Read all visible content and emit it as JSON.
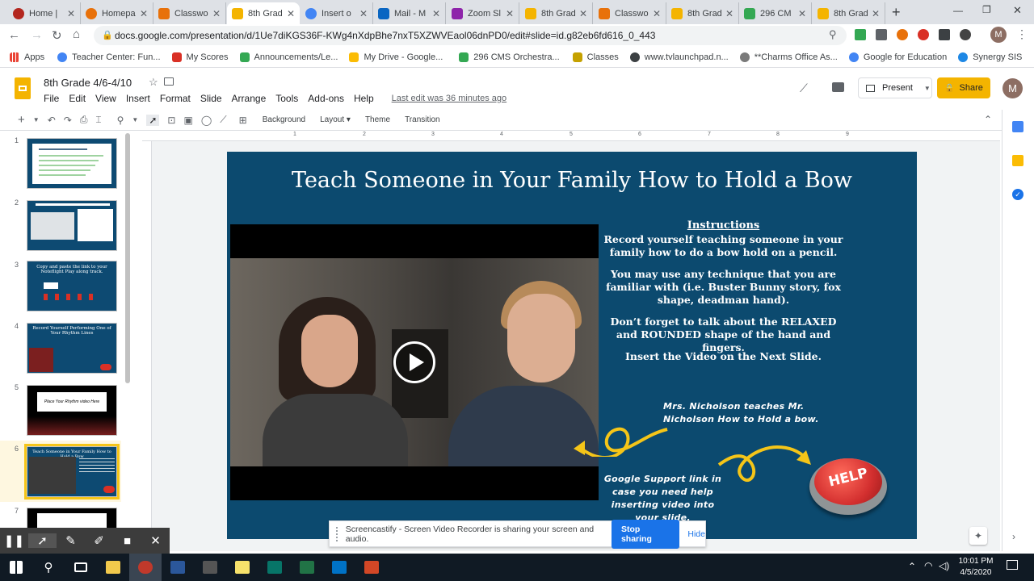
{
  "tabs": [
    {
      "label": "Home |",
      "color": "#b3261e"
    },
    {
      "label": "Homepa",
      "color": "#e8710a"
    },
    {
      "label": "Classwo",
      "color": "#e8710a"
    },
    {
      "label": "8th Grad",
      "color": "#f4b400"
    },
    {
      "label": "Insert o",
      "color": "#4285f4"
    },
    {
      "label": "Mail - M",
      "color": "#0a66c2"
    },
    {
      "label": "Zoom Sl",
      "color": "#8e24aa"
    },
    {
      "label": "8th Grad",
      "color": "#f4b400"
    },
    {
      "label": "Classwo",
      "color": "#e8710a"
    },
    {
      "label": "8th Grad",
      "color": "#f4b400"
    },
    {
      "label": "296 CM",
      "color": "#34a853"
    },
    {
      "label": "8th Grad",
      "color": "#f4b400"
    }
  ],
  "url": "docs.google.com/presentation/d/1Ue7diKGS36F-KWg4nXdpBhe7nxT5XZWVEaol06dnPD0/edit#slide=id.g82eb6fd616_0_443",
  "bookmarks": [
    "Apps",
    "Teacher Center: Fun...",
    "My Scores",
    "Announcements/Le...",
    "My Drive - Google...",
    "296 CMS Orchestra...",
    "Classes",
    "www.tvlaunchpad.n...",
    "**Charms Office As...",
    "Google for Education",
    "Synergy SIS"
  ],
  "doc": {
    "title": "8th Grade 4/6-4/10",
    "menu": [
      "File",
      "Edit",
      "View",
      "Insert",
      "Format",
      "Slide",
      "Arrange",
      "Tools",
      "Add-ons",
      "Help"
    ],
    "last_edit": "Last edit was 36 minutes ago",
    "present_label": "Present",
    "share_label": "Share",
    "avatar": "M"
  },
  "toolbar": {
    "background": "Background",
    "layout": "Layout",
    "theme": "Theme",
    "transition": "Transition"
  },
  "ruler": [
    "1",
    "2",
    "3",
    "4",
    "5",
    "6",
    "7",
    "8",
    "9"
  ],
  "filmstrip": {
    "numbers": [
      "1",
      "2",
      "3",
      "4",
      "5",
      "6",
      "7"
    ],
    "selected": "6",
    "texts": {
      "t3": "Copy and paste the link to your Noteflight Play along track.",
      "t4": "Record Yourself Performing One of Your Rhythm Lines",
      "t5": "Place Your Rhythm video Here",
      "t6": "Teach Someone in Your Family How to Hold a Bow"
    }
  },
  "slide": {
    "title": "Teach Someone in Your Family How to Hold a Bow",
    "instructions_heading": "Instructions",
    "para1": "Record yourself teaching someone in your family how to do a bow hold on a pencil.",
    "para2": "You may use any technique that you are familiar with (i.e. Buster Bunny story, fox shape, deadman hand).",
    "para3": "Don’t forget to talk about the RELAXED and ROUNDED shape of the hand and fingers.",
    "para4": "Insert the Video on the Next Slide.",
    "annotation1": "Mrs. Nicholson teaches Mr. Nicholson How to Hold a bow.",
    "annotation2": "Google Support link in case you need help inserting video into your slide.",
    "help_button": "HELP",
    "arrow_color": "#f5c518"
  },
  "screencastify": {
    "message": "Screencastify - Screen Video Recorder is sharing your screen and audio.",
    "stop": "Stop sharing",
    "hide": "Hide"
  },
  "taskbar": {
    "time": "10:01 PM",
    "date": "4/5/2020"
  }
}
